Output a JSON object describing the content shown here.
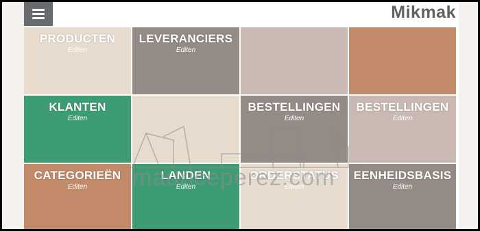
{
  "header": {
    "brand": "Mikmak",
    "menu_icon": "hamburger-menu-icon"
  },
  "tiles": [
    {
      "title": "PRODUCTEN",
      "subtitle": "Editen",
      "color": "#e8dccf"
    },
    {
      "title": "LEVERANCIERS",
      "subtitle": "Editen",
      "color": "#948b86"
    },
    {
      "title": "",
      "subtitle": "",
      "color": "#cab9b3"
    },
    {
      "title": "",
      "subtitle": "",
      "color": "#c38a6a"
    },
    {
      "title": "KLANTEN",
      "subtitle": "Editen",
      "color": "#3d9c73"
    },
    {
      "title": "",
      "subtitle": "",
      "color": "#e8dccf"
    },
    {
      "title": "BESTELLINGEN",
      "subtitle": "Editen",
      "color": "#948b86"
    },
    {
      "title": "BESTELLINGEN",
      "subtitle": "Editen",
      "color": "#cab9b3"
    },
    {
      "title": "CATEGORIEËN",
      "subtitle": "Editen",
      "color": "#c38a6a"
    },
    {
      "title": "LANDEN",
      "subtitle": "Editen",
      "color": "#3d9c73"
    },
    {
      "title": "ORDERSTATUS",
      "subtitle": "Editen",
      "color": "#e8dccf"
    },
    {
      "title": "EENHEIDSBASIS",
      "subtitle": "Editen",
      "color": "#948b86"
    }
  ],
  "watermark": {
    "text": "mauriceperez.com"
  }
}
